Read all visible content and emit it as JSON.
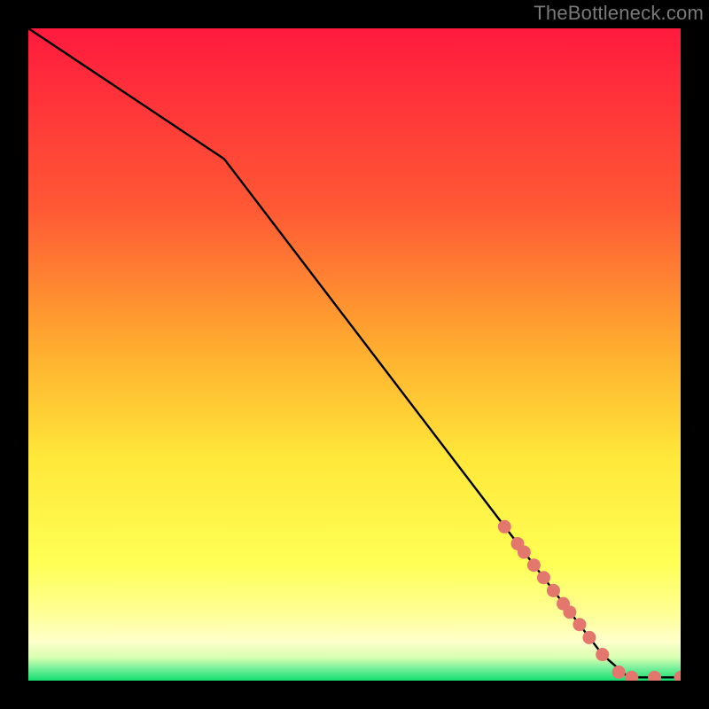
{
  "watermark": "TheBottleneck.com",
  "colors": {
    "red": "#ff1a3e",
    "orange": "#ff8a2a",
    "yellowTop": "#ffe83a",
    "yellowMid": "#ffff55",
    "yellowBright": "#ffff88",
    "paleYellow": "#ffffcc",
    "green": "#14de6f",
    "curve": "#000000",
    "marker": "#e4776d"
  },
  "chart_data": {
    "type": "line",
    "title": "",
    "xlabel": "",
    "ylabel": "",
    "xlim": [
      0,
      100
    ],
    "ylim": [
      0,
      100
    ],
    "curve": {
      "x": [
        0,
        30,
        88,
        92,
        96,
        100
      ],
      "y": [
        100,
        80,
        4,
        0.5,
        0.5,
        0.5
      ]
    },
    "markers": {
      "x": [
        73,
        75,
        76,
        77.5,
        79,
        80.5,
        82,
        83,
        84.5,
        86,
        88,
        90.5,
        92.5,
        96,
        100
      ],
      "y": [
        23.6,
        21.0,
        19.7,
        17.7,
        15.8,
        13.8,
        11.8,
        10.5,
        8.6,
        6.6,
        4.0,
        1.3,
        0.5,
        0.5,
        0.5
      ]
    }
  }
}
